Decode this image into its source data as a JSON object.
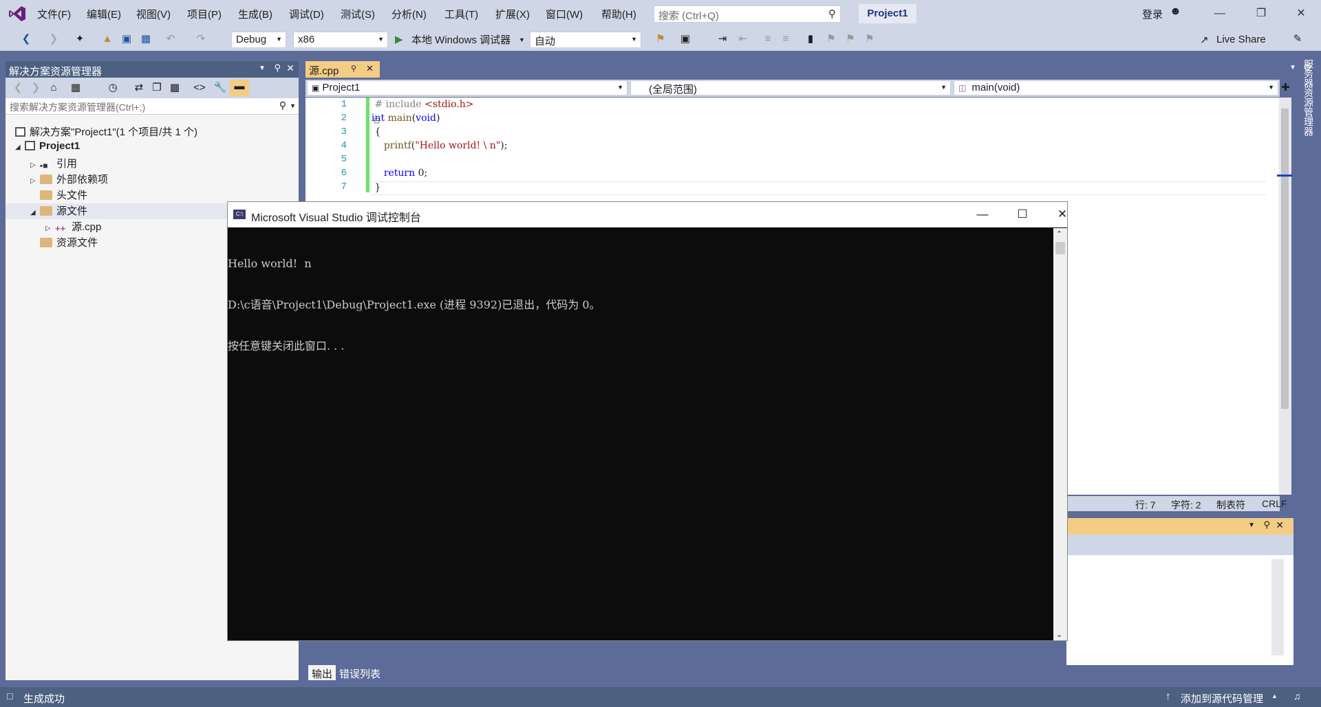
{
  "titlebar": {
    "menu": [
      "文件(F)",
      "编辑(E)",
      "视图(V)",
      "项目(P)",
      "生成(B)",
      "调试(D)",
      "测试(S)",
      "分析(N)",
      "工具(T)",
      "扩展(X)",
      "窗口(W)",
      "帮助(H)"
    ],
    "search_placeholder": "搜索 (Ctrl+Q)",
    "project_name": "Project1",
    "login": "登录"
  },
  "toolbar": {
    "config": "Debug",
    "platform": "x86",
    "run_label": "本地 Windows 调试器",
    "run_mode": "自动",
    "live_share": "Live Share"
  },
  "solution_explorer": {
    "title": "解决方案资源管理器",
    "search_placeholder": "搜索解决方案资源管理器(Ctrl+;)",
    "tree": [
      {
        "label": "解决方案\"Project1\"(1 个项目/共 1 个)"
      },
      {
        "label": "Project1"
      },
      {
        "label": "引用"
      },
      {
        "label": "外部依赖项"
      },
      {
        "label": "头文件"
      },
      {
        "label": "源文件"
      },
      {
        "label": "源.cpp"
      },
      {
        "label": "资源文件"
      }
    ]
  },
  "editor": {
    "tab": "源.cpp",
    "nav_project": "Project1",
    "nav_scope": "(全局范围)",
    "nav_member": "main(void)",
    "line_numbers": [
      "1",
      "2",
      "3",
      "4",
      "5",
      "6",
      "7"
    ],
    "status": {
      "line": "行: 7",
      "char": "字符: 2",
      "indent": "制表符",
      "eol": "CRLF"
    }
  },
  "console": {
    "title": "Microsoft Visual Studio 调试控制台",
    "lines": [
      "Hello world!  n",
      "D:\\c语音\\Project1\\Debug\\Project1.exe (进程 9392)已退出，代码为 0。",
      "按任意键关闭此窗口. . ."
    ]
  },
  "bottom_tabs": [
    "输出",
    "错误列表"
  ],
  "server_explorer": "服务器资源管理器",
  "statusbar": {
    "left": "生成成功",
    "right": "添加到源代码管理"
  }
}
